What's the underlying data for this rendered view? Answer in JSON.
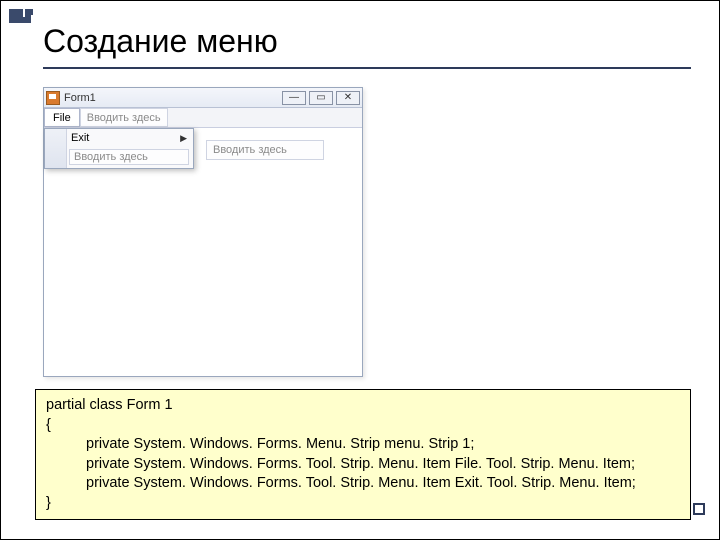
{
  "slide": {
    "title": "Создание меню"
  },
  "form": {
    "title": "Form1",
    "minimize_glyph": "—",
    "maximize_glyph": "▭",
    "close_glyph": "✕",
    "menu": {
      "file_label": "File",
      "type_here_1": "Вводить здесь",
      "dropdown": {
        "exit_label": "Exit",
        "type_here_2": "Вводить здесь"
      },
      "side_type_here": "Вводить здесь"
    }
  },
  "code": {
    "l1": "partial class Form 1",
    "l2": "{",
    "l3": "private System. Windows. Forms. Menu. Strip    menu. Strip 1;",
    "l4": "private System. Windows. Forms. Tool. Strip. Menu. Item    File. Tool. Strip. Menu. Item;",
    "l5": "private System. Windows. Forms. Tool. Strip. Menu. Item    Exit. Tool. Strip. Menu. Item;",
    "l6": "}"
  }
}
